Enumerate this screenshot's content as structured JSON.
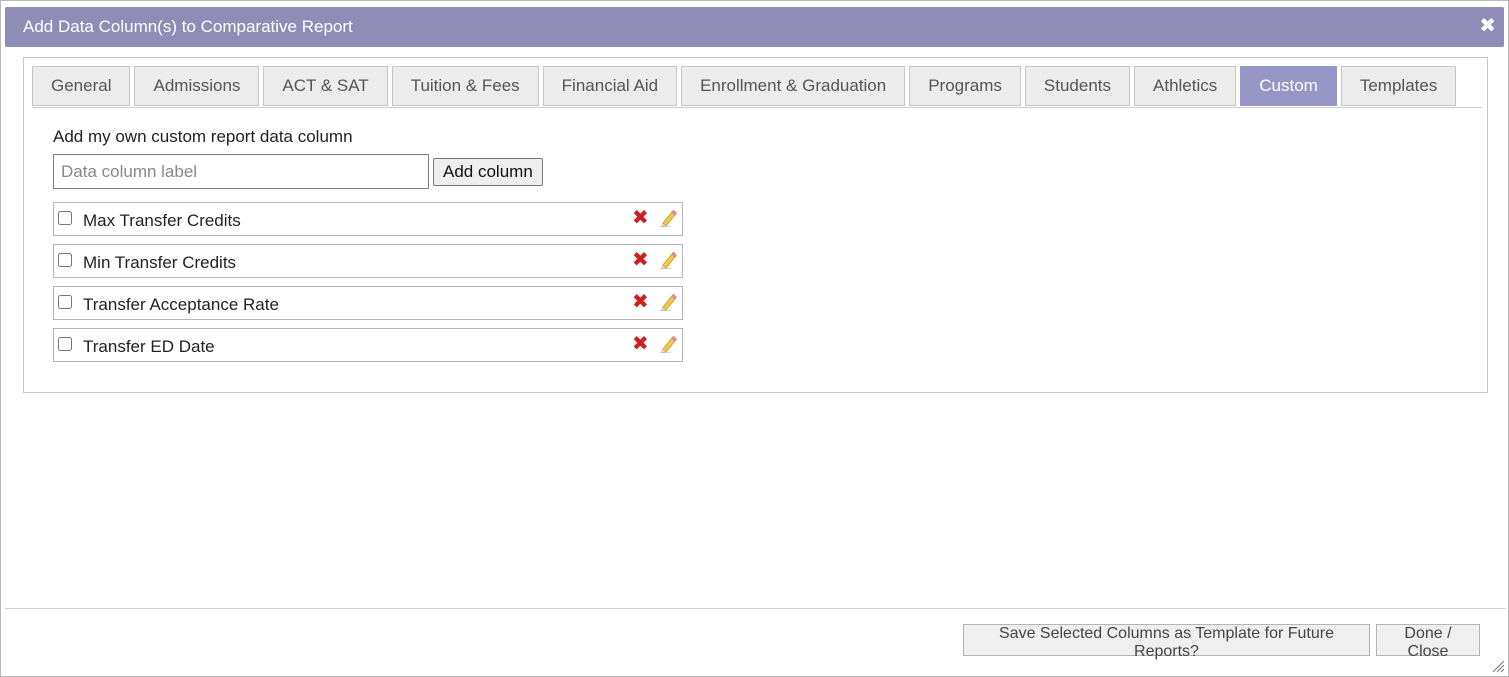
{
  "dialog": {
    "title": "Add Data Column(s) to Comparative Report",
    "close_glyph": "✖",
    "title_bar_color": "#8f8db8"
  },
  "tabs": [
    {
      "label": "General",
      "active": false
    },
    {
      "label": "Admissions",
      "active": false
    },
    {
      "label": "ACT & SAT",
      "active": false
    },
    {
      "label": "Tuition & Fees",
      "active": false
    },
    {
      "label": "Financial Aid",
      "active": false
    },
    {
      "label": "Enrollment & Graduation",
      "active": false
    },
    {
      "label": "Programs",
      "active": false
    },
    {
      "label": "Students",
      "active": false
    },
    {
      "label": "Athletics",
      "active": false
    },
    {
      "label": "Custom",
      "active": true
    },
    {
      "label": "Templates",
      "active": false
    }
  ],
  "custom": {
    "heading": "Add my own custom report data column",
    "input_placeholder": "Data column label",
    "input_value": "",
    "add_button": "Add column",
    "columns": [
      {
        "label": "Max Transfer Credits",
        "checked": false
      },
      {
        "label": "Min Transfer Credits",
        "checked": false
      },
      {
        "label": "Transfer Acceptance Rate",
        "checked": false
      },
      {
        "label": "Transfer ED Date",
        "checked": false
      }
    ],
    "delete_icon": "✖",
    "delete_color": "#cc1f1f"
  },
  "footer": {
    "save_template": "Save Selected Columns as Template for Future Reports?",
    "done": "Done / Close"
  },
  "icons": {
    "close": "close-icon",
    "delete": "delete-icon",
    "edit": "pencil-icon",
    "resize": "resize-grip-icon"
  }
}
